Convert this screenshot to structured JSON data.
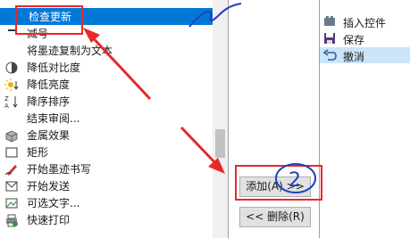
{
  "left_list": {
    "items": [
      {
        "label": "检查更新",
        "icon": "check-update-icon",
        "selected": true
      },
      {
        "label": "减号",
        "icon": "minus-icon"
      },
      {
        "label": "将墨迹复制为文本",
        "icon": "blank-icon"
      },
      {
        "label": "降低对比度",
        "icon": "contrast-icon"
      },
      {
        "label": "降低亮度",
        "icon": "brightness-icon"
      },
      {
        "label": "降序排序",
        "icon": "sort-descending-icon"
      },
      {
        "label": "结束审阅...",
        "icon": "blank-icon"
      },
      {
        "label": "金属效果",
        "icon": "metal-effect-icon"
      },
      {
        "label": "矩形",
        "icon": "rectangle-icon"
      },
      {
        "label": "开始墨迹书写",
        "icon": "ink-pen-icon"
      },
      {
        "label": "开始发送",
        "icon": "send-icon"
      },
      {
        "label": "可选文字...",
        "icon": "alt-text-icon"
      },
      {
        "label": "快速打印",
        "icon": "quick-print-icon"
      }
    ]
  },
  "buttons": {
    "add": "添加(A) >>",
    "remove": "<< 删除(R)"
  },
  "right_list": {
    "items": [
      {
        "label": "插入控件",
        "icon": "insert-control-icon"
      },
      {
        "label": "保存",
        "icon": "save-icon"
      },
      {
        "label": "撤消",
        "icon": "undo-icon",
        "selected": true
      }
    ]
  },
  "annotations": {
    "handwritten_numeral": "2",
    "highlight_color": "#e8282a",
    "arrow_color": "#e8282a",
    "scribble_color": "#1f3fbf"
  }
}
